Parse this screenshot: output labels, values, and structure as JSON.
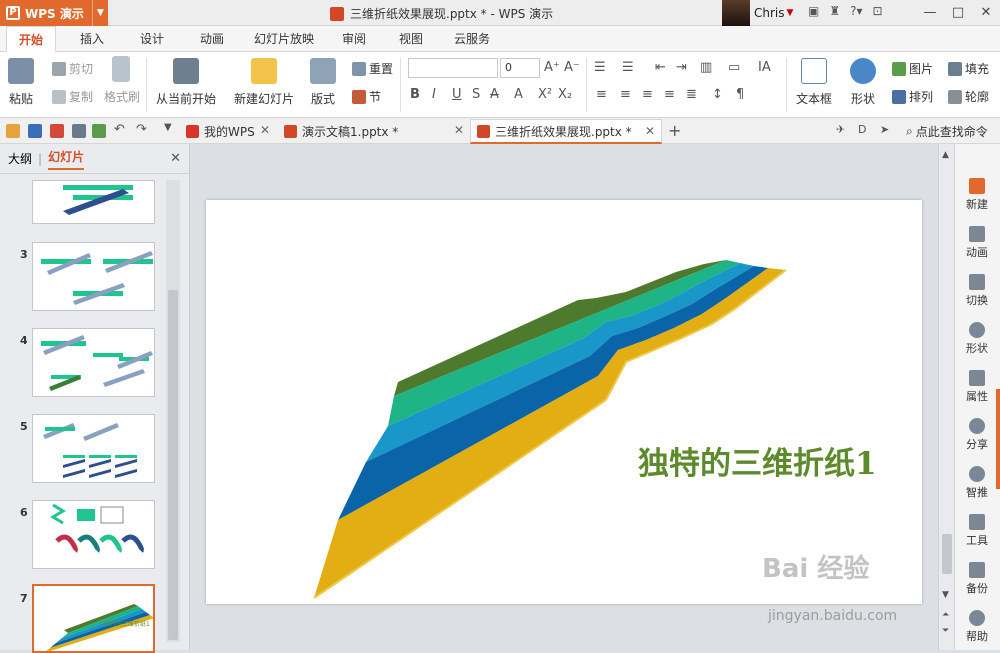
{
  "app": {
    "name": "WPS 演示"
  },
  "window": {
    "title": "三维折纸效果展现.pptx * - WPS 演示"
  },
  "user": {
    "name": "Chris"
  },
  "titlebar_icons": [
    "skin-icon",
    "shirt-icon",
    "help-icon",
    "box-icon"
  ],
  "menu": {
    "tabs": [
      "开始",
      "插入",
      "设计",
      "动画",
      "幻灯片放映",
      "审阅",
      "视图",
      "云服务"
    ]
  },
  "ribbon": {
    "paste": "粘贴",
    "cut": "剪切",
    "copy": "复制",
    "format_painter": "格式刷",
    "from_current": "从当前开始",
    "new_slide": "新建幻灯片",
    "layout": "版式",
    "reset": "重置",
    "section": "节",
    "font_size": "0",
    "textbox": "文本框",
    "shape": "形状",
    "picture": "图片",
    "fill": "填充",
    "arrange": "排列",
    "outline": "轮廓"
  },
  "tabs": {
    "my_wps": "我的WPS",
    "doc1": "演示文稿1.pptx *",
    "doc2": "三维折纸效果展现.pptx *",
    "search_cmd": "点此查找命令"
  },
  "leftpane": {
    "outline_tab": "大纲",
    "slides_tab": "幻灯片",
    "slide_numbers": [
      "3",
      "4",
      "5",
      "6",
      "7"
    ]
  },
  "slide": {
    "title": "独特的三维折纸1"
  },
  "sidebar": {
    "items": [
      "新建",
      "动画",
      "切换",
      "形状",
      "属性",
      "分享",
      "智推",
      "工具",
      "备份",
      "帮助"
    ]
  },
  "watermark": {
    "main": "Bai 经验",
    "url": "jingyan.baidu.com"
  },
  "colors": {
    "accent": "#e2692d",
    "band_olive": "#4e7a2e",
    "band_green": "#1fb486",
    "band_teal": "#1a97c9",
    "band_blue": "#0a64a8",
    "band_gold": "#e2ae14"
  }
}
